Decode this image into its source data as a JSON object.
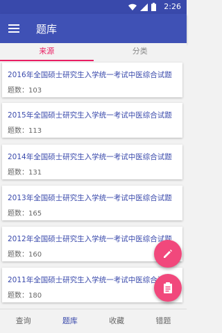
{
  "status_bar": {
    "time": "2:26"
  },
  "app_bar": {
    "title": "题库"
  },
  "tabs": [
    {
      "label": "来源",
      "active": true
    },
    {
      "label": "分类",
      "active": false
    }
  ],
  "items": [
    {
      "title": "2016年全国硕士研究生入学统一考试中医综合试题",
      "count": "题数：103"
    },
    {
      "title": "2015年全国硕士研究生入学统一考试中医综合试题",
      "count": "题数：113"
    },
    {
      "title": "2014年全国硕士研究生入学统一考试中医综合试题",
      "count": "题数：131"
    },
    {
      "title": "2013年全国硕士研究生入学统一考试中医综合试题",
      "count": "题数：165"
    },
    {
      "title": "2012年全国硕士研究生入学统一考试中医综合试题",
      "count": "题数：160"
    },
    {
      "title": "2011年全国硕士研究生入学统一考试中医综合试题",
      "count": "题数：180"
    }
  ],
  "fabs": [
    {
      "icon": "pencil-icon"
    },
    {
      "icon": "clipboard-icon"
    }
  ],
  "bottom_nav": [
    {
      "label": "查询",
      "active": false
    },
    {
      "label": "题库",
      "active": true
    },
    {
      "label": "收藏",
      "active": false
    },
    {
      "label": "错题",
      "active": false
    }
  ],
  "colors": {
    "primary": "#3f51b5",
    "accent": "#e91e63",
    "fab": "#f1487c"
  }
}
